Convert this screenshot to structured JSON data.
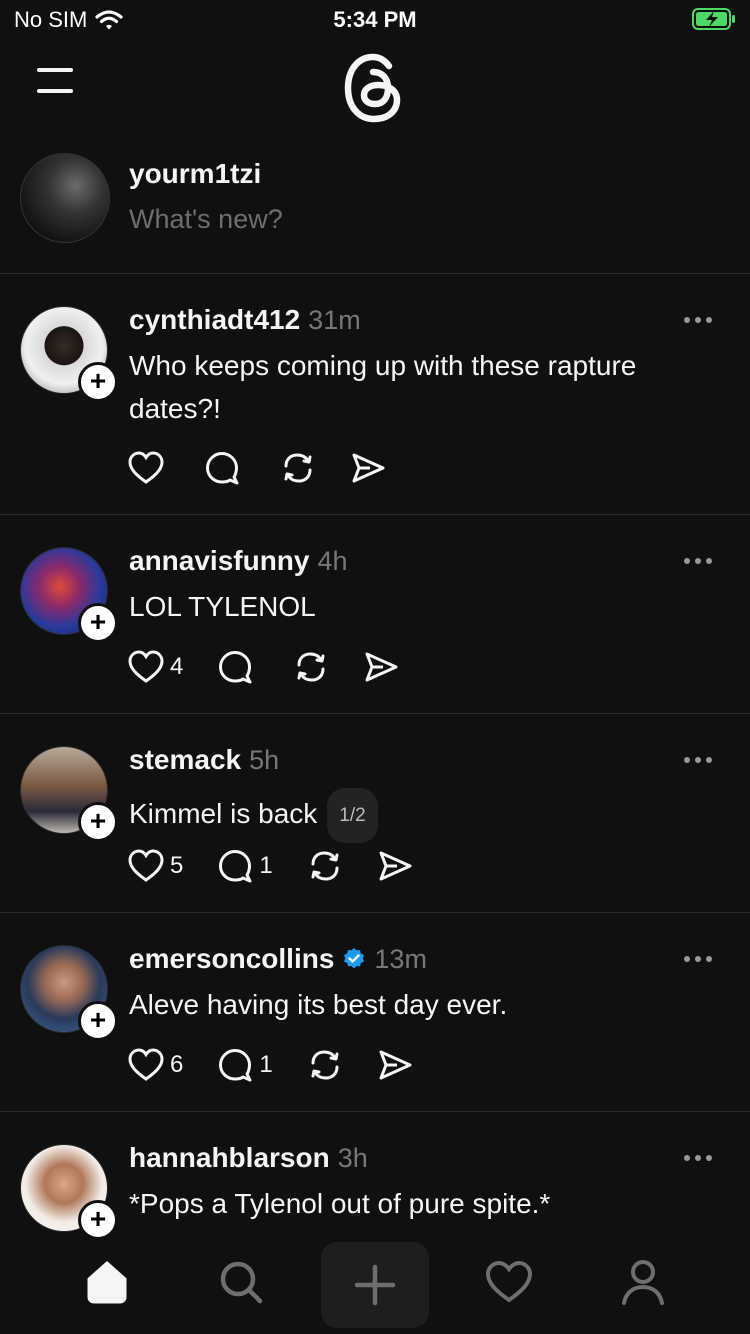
{
  "status_bar": {
    "carrier": "No SIM",
    "time": "5:34 PM"
  },
  "composer": {
    "username": "yourm1tzi",
    "placeholder": "What's new?"
  },
  "posts": [
    {
      "username": "cynthiadt412",
      "time": "31m",
      "text": "Who keeps coming up with these rapture dates?!",
      "likes": "",
      "replies": "",
      "verified": false
    },
    {
      "username": "annavisfunny",
      "time": "4h",
      "text": "LOL TYLENOL",
      "likes": "4",
      "replies": "",
      "verified": false
    },
    {
      "username": "stemack",
      "time": "5h",
      "text": "Kimmel is back",
      "pager": "1/2",
      "likes": "5",
      "replies": "1",
      "verified": false
    },
    {
      "username": "emersoncollins",
      "time": "13m",
      "text": "Aleve having its best day ever.",
      "likes": "6",
      "replies": "1",
      "verified": true
    },
    {
      "username": "hannahblarson",
      "time": "3h",
      "text": "*Pops a Tylenol out of pure spite.*",
      "likes": "",
      "replies": "",
      "verified": false
    }
  ],
  "colors": {
    "background": "#101010",
    "text": "#f3f5f7",
    "muted": "#777777",
    "verified": "#1d9bf0",
    "battery": "#4cd964"
  },
  "tabbar": {
    "items": [
      "home-icon",
      "search-icon",
      "compose-icon",
      "activity-heart-icon",
      "profile-icon"
    ]
  }
}
